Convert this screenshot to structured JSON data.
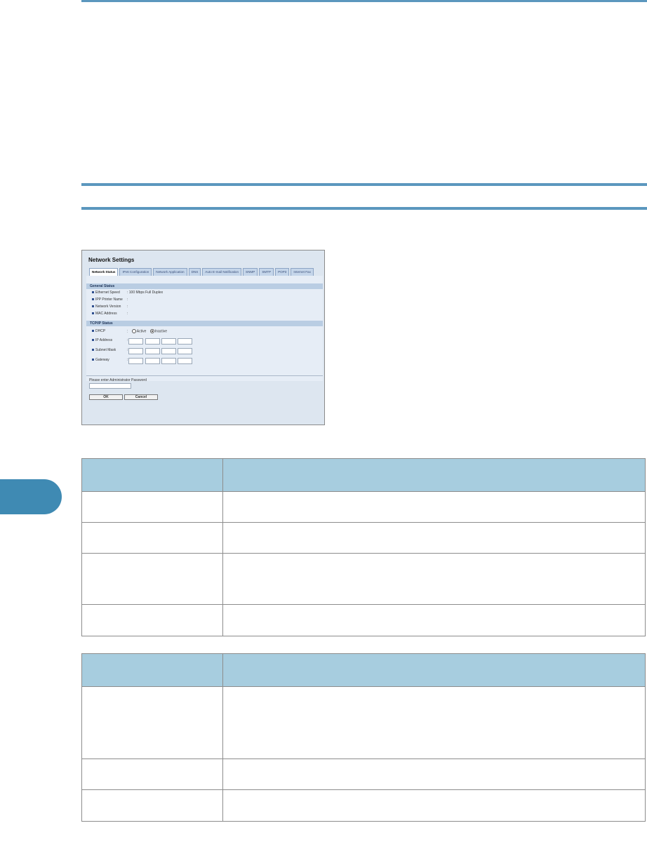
{
  "colors": {
    "accent": "#5b97be",
    "table_header": "#a7cddf",
    "chapter_tab": "#3f8ab3"
  },
  "screenshot": {
    "title": "Network Settings",
    "tabs": [
      "Network Status",
      "IPv6 Configuration",
      "Network Application",
      "DNS",
      "Auto E-mail Notification",
      "SNMP",
      "SMTP",
      "POP3",
      "Internet Fax"
    ],
    "general_status": {
      "heading": "General Status",
      "rows": [
        {
          "label": "Ethernet Speed",
          "value": ": 100 Mbps Full Duplex"
        },
        {
          "label": "IPP Printer Name",
          "value": ":"
        },
        {
          "label": "Network Version",
          "value": ":"
        },
        {
          "label": "MAC Address",
          "value": ":"
        }
      ]
    },
    "tcpip_status": {
      "heading": "TCP/IP Status",
      "dhcp": {
        "label": "DHCP",
        "colon": ":",
        "option_active": "Active",
        "option_inactive": "Inactive",
        "selected": "Inactive"
      },
      "ip_rows": [
        {
          "label": "IP Address",
          "colon": ":"
        },
        {
          "label": "Subnet Mask",
          "colon": ":"
        },
        {
          "label": "Gateway",
          "colon": ":"
        }
      ]
    },
    "password_label": "Please enter Administrator Password",
    "ok_label": "OK",
    "cancel_label": "Cancel"
  },
  "table1": {
    "rows": 4
  },
  "table2": {
    "rows": 3
  }
}
